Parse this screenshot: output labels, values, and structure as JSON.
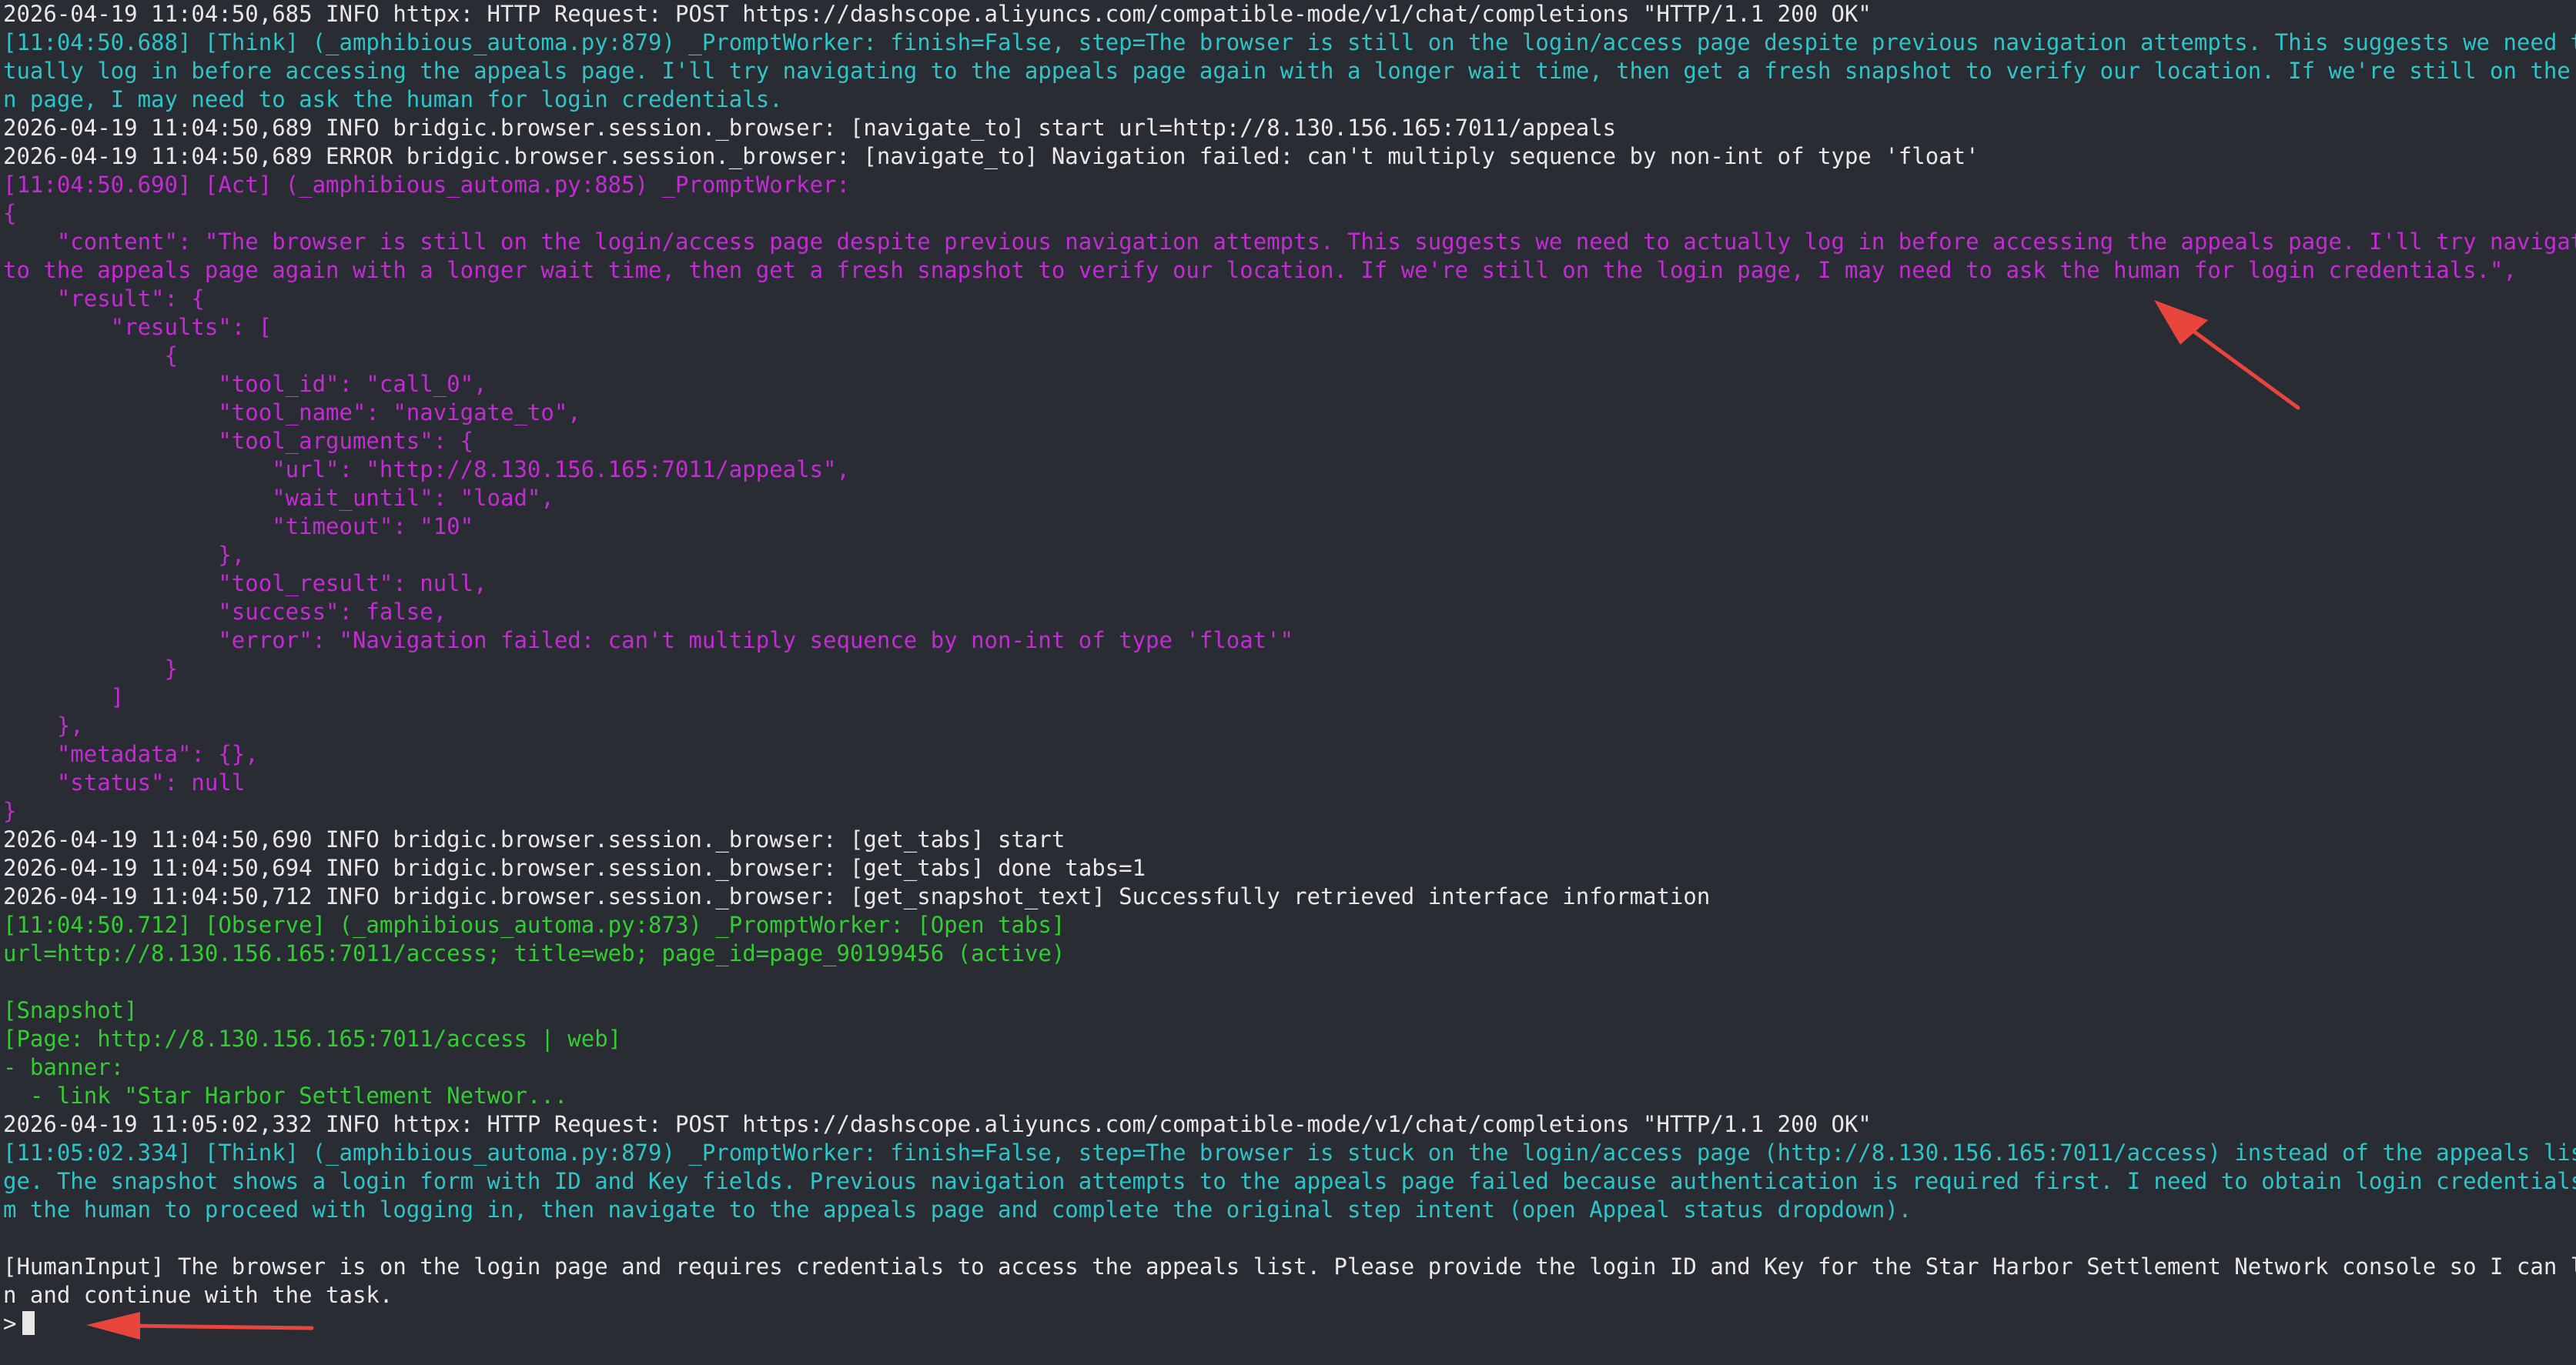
{
  "colors": {
    "background": "#292c33",
    "log_text": "#e8e8e8",
    "think": "#2fc4c8",
    "act": "#c42bd4",
    "observe": "#33cc33",
    "annotation_arrow": "#e8453c"
  },
  "lines": [
    {
      "text": "2026-04-19 11:04:50,685 INFO httpx: HTTP Request: POST https://dashscope.aliyuncs.com/compatible-mode/v1/chat/completions \"HTTP/1.1 200 OK\"",
      "color": "white"
    },
    {
      "text": "[11:04:50.688] [Think] (_amphibious_automa.py:879) _PromptWorker: finish=False, step=The browser is still on the login/access page despite previous navigation attempts. This suggests we need to ac",
      "color": "cyan"
    },
    {
      "text": "tually log in before accessing the appeals page. I'll try navigating to the appeals page again with a longer wait time, then get a fresh snapshot to verify our location. If we're still on the logi",
      "color": "cyan"
    },
    {
      "text": "n page, I may need to ask the human for login credentials.",
      "color": "cyan"
    },
    {
      "text": "2026-04-19 11:04:50,689 INFO bridgic.browser.session._browser: [navigate_to] start url=http://8.130.156.165:7011/appeals",
      "color": "white"
    },
    {
      "text": "2026-04-19 11:04:50,689 ERROR bridgic.browser.session._browser: [navigate_to] Navigation failed: can't multiply sequence by non-int of type 'float'",
      "color": "white"
    },
    {
      "text": "[11:04:50.690] [Act] (_amphibious_automa.py:885) _PromptWorker:",
      "color": "magenta"
    },
    {
      "text": "{",
      "color": "magenta"
    },
    {
      "text": "    \"content\": \"The browser is still on the login/access page despite previous navigation attempts. This suggests we need to actually log in before accessing the appeals page. I'll try navigating",
      "color": "magenta"
    },
    {
      "text": "to the appeals page again with a longer wait time, then get a fresh snapshot to verify our location. If we're still on the login page, I may need to ask the human for login credentials.\",",
      "color": "magenta"
    },
    {
      "text": "    \"result\": {",
      "color": "magenta"
    },
    {
      "text": "        \"results\": [",
      "color": "magenta"
    },
    {
      "text": "            {",
      "color": "magenta"
    },
    {
      "text": "                \"tool_id\": \"call_0\",",
      "color": "magenta"
    },
    {
      "text": "                \"tool_name\": \"navigate_to\",",
      "color": "magenta"
    },
    {
      "text": "                \"tool_arguments\": {",
      "color": "magenta"
    },
    {
      "text": "                    \"url\": \"http://8.130.156.165:7011/appeals\",",
      "color": "magenta"
    },
    {
      "text": "                    \"wait_until\": \"load\",",
      "color": "magenta"
    },
    {
      "text": "                    \"timeout\": \"10\"",
      "color": "magenta"
    },
    {
      "text": "                },",
      "color": "magenta"
    },
    {
      "text": "                \"tool_result\": null,",
      "color": "magenta"
    },
    {
      "text": "                \"success\": false,",
      "color": "magenta"
    },
    {
      "text": "                \"error\": \"Navigation failed: can't multiply sequence by non-int of type 'float'\"",
      "color": "magenta"
    },
    {
      "text": "            }",
      "color": "magenta"
    },
    {
      "text": "        ]",
      "color": "magenta"
    },
    {
      "text": "    },",
      "color": "magenta"
    },
    {
      "text": "    \"metadata\": {},",
      "color": "magenta"
    },
    {
      "text": "    \"status\": null",
      "color": "magenta"
    },
    {
      "text": "}",
      "color": "magenta"
    },
    {
      "text": "2026-04-19 11:04:50,690 INFO bridgic.browser.session._browser: [get_tabs] start",
      "color": "white"
    },
    {
      "text": "2026-04-19 11:04:50,694 INFO bridgic.browser.session._browser: [get_tabs] done tabs=1",
      "color": "white"
    },
    {
      "text": "2026-04-19 11:04:50,712 INFO bridgic.browser.session._browser: [get_snapshot_text] Successfully retrieved interface information",
      "color": "white"
    },
    {
      "text": "[11:04:50.712] [Observe] (_amphibious_automa.py:873) _PromptWorker: [Open tabs]",
      "color": "green"
    },
    {
      "text": "url=http://8.130.156.165:7011/access; title=web; page_id=page_90199456 (active)",
      "color": "green"
    },
    {
      "text": "",
      "color": "green"
    },
    {
      "text": "[Snapshot]",
      "color": "green"
    },
    {
      "text": "[Page: http://8.130.156.165:7011/access | web]",
      "color": "green"
    },
    {
      "text": "- banner:",
      "color": "green"
    },
    {
      "text": "  - link \"Star Harbor Settlement Networ...",
      "color": "green"
    },
    {
      "text": "2026-04-19 11:05:02,332 INFO httpx: HTTP Request: POST https://dashscope.aliyuncs.com/compatible-mode/v1/chat/completions \"HTTP/1.1 200 OK\"",
      "color": "white"
    },
    {
      "text": "[11:05:02.334] [Think] (_amphibious_automa.py:879) _PromptWorker: finish=False, step=The browser is stuck on the login/access page (http://8.130.156.165:7011/access) instead of the appeals list pa",
      "color": "cyan"
    },
    {
      "text": "ge. The snapshot shows a login form with ID and Key fields. Previous navigation attempts to the appeals page failed because authentication is required first. I need to obtain login credentials fro",
      "color": "cyan"
    },
    {
      "text": "m the human to proceed with logging in, then navigate to the appeals page and complete the original step intent (open Appeal status dropdown).",
      "color": "cyan"
    },
    {
      "text": "",
      "color": "white"
    },
    {
      "text": "[HumanInput] The browser is on the login page and requires credentials to access the appeals list. Please provide the login ID and Key for the Star Harbor Settlement Network console so I can log i",
      "color": "white"
    },
    {
      "text": "n and continue with the task.",
      "color": "white"
    }
  ],
  "prompt": {
    "symbol": ">",
    "input_value": ""
  }
}
